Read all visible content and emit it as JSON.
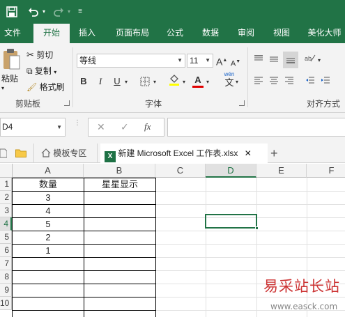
{
  "quick_access": {
    "save_icon": "save-icon",
    "undo_icon": "undo-icon",
    "redo_icon": "redo-icon",
    "customize_icon": "customize-icon"
  },
  "tabs": [
    "文件",
    "开始",
    "插入",
    "页面布局",
    "公式",
    "数据",
    "审阅",
    "视图",
    "美化大师"
  ],
  "active_tab": "开始",
  "ribbon": {
    "clipboard": {
      "paste": "粘贴",
      "cut": "剪切",
      "copy": "复制",
      "format_painter": "格式刷",
      "group_label": "剪贴板"
    },
    "font": {
      "font_name": "等线",
      "font_size": "11",
      "bold": "B",
      "italic": "I",
      "underline": "U",
      "grow": "A",
      "shrink": "A",
      "font_color": "A",
      "phonetic": "wén",
      "phonetic_char": "文",
      "group_label": "字体"
    },
    "alignment": {
      "group_label": "对齐方式"
    }
  },
  "formula_bar": {
    "name_box": "D4",
    "fx": "fx",
    "value": ""
  },
  "doc_tabs": {
    "template_tab": "模板专区",
    "file_tab": "新建 Microsoft Excel 工作表.xlsx",
    "add": "+"
  },
  "sheet": {
    "columns": [
      "A",
      "B",
      "C",
      "D",
      "E",
      "F"
    ],
    "rows": [
      "1",
      "2",
      "3",
      "4",
      "5",
      "6",
      "7",
      "8",
      "9",
      "10"
    ],
    "selected_cell": "D4",
    "header_row": [
      "数量",
      "星星显示"
    ],
    "values": [
      "3",
      "4",
      "5",
      "2",
      "1"
    ]
  },
  "watermark": {
    "title": "易采站长站",
    "url": "www.easck.com"
  }
}
